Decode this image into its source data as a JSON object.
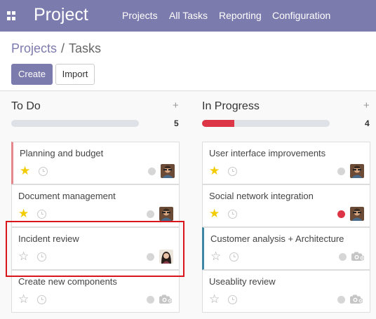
{
  "navbar": {
    "brand": "Project",
    "menu": [
      "Projects",
      "All Tasks",
      "Reporting",
      "Configuration"
    ],
    "bg_color": "#7c7bad"
  },
  "breadcrumb": {
    "parent": "Projects",
    "separator": "/",
    "current": "Tasks"
  },
  "buttons": {
    "create": "Create",
    "import": "Import"
  },
  "columns": [
    {
      "title": "To Do",
      "count": "5",
      "progress": 0,
      "cards": [
        {
          "title": "Planning and budget",
          "starred": true,
          "state_color": "#d6d6d6",
          "avatar": "man-avatar",
          "highlight": "red"
        },
        {
          "title": "Document management",
          "starred": true,
          "state_color": "#d6d6d6",
          "avatar": "man-avatar",
          "highlight": "none"
        },
        {
          "title": "Incident review",
          "starred": false,
          "state_color": "#d6d6d6",
          "avatar": "woman-avatar",
          "highlight": "none"
        },
        {
          "title": "Create new components",
          "starred": false,
          "state_color": "#d6d6d6",
          "avatar": "camera-placeholder",
          "highlight": "none"
        }
      ]
    },
    {
      "title": "In Progress",
      "count": "4",
      "progress": 0.25,
      "cards": [
        {
          "title": "User interface improvements",
          "starred": true,
          "state_color": "#d6d6d6",
          "avatar": "man-avatar",
          "highlight": "none"
        },
        {
          "title": "Social network integration",
          "starred": true,
          "state_color": "#dc3545",
          "avatar": "man-avatar",
          "highlight": "none"
        },
        {
          "title": "Customer analysis + Architecture",
          "starred": false,
          "state_color": "#d6d6d6",
          "avatar": "camera-placeholder",
          "highlight": "blue"
        },
        {
          "title": "Useablity review",
          "starred": false,
          "state_color": "#d6d6d6",
          "avatar": "camera-placeholder",
          "highlight": "none"
        }
      ]
    }
  ]
}
